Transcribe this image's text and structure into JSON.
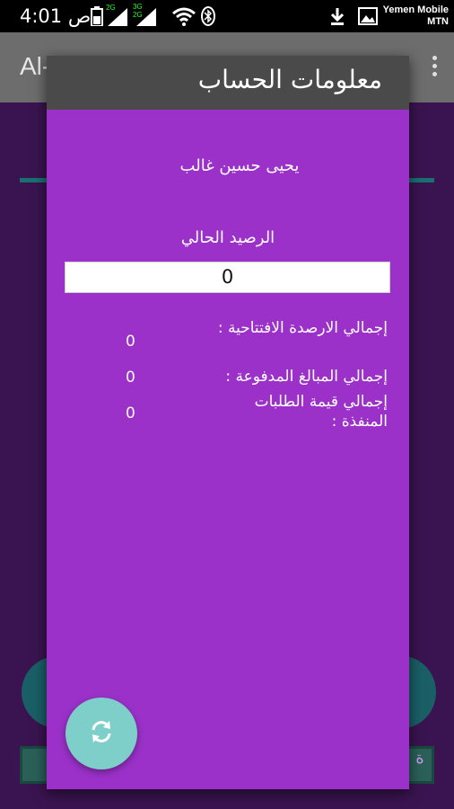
{
  "status_bar": {
    "time": "4:01 ص",
    "carrier_line1": "Yemen Mobile",
    "carrier_line2": "MTN",
    "net_label_1": "2G",
    "net_label_2a": "3G",
    "net_label_2b": "2G"
  },
  "background_app": {
    "title": "Al-",
    "bottom_right_char": "ة"
  },
  "dialog": {
    "title": "معلومات الحساب",
    "owner_name": "يحيى حسين غالب",
    "balance_label": "الرصيد الحالي",
    "balance_value": "0",
    "rows": [
      {
        "label": "إجمالي الارصدة الافتتاحية :",
        "value": "0"
      },
      {
        "label": "إجمالي المبالغ المدفوعة :",
        "value": "0"
      },
      {
        "label": "إجمالي قيمة الطلبات المنفذة :",
        "value": "0"
      }
    ]
  },
  "icons": {
    "refresh": "refresh-icon",
    "download": "download-icon",
    "image": "image-icon",
    "wifi": "wifi-icon",
    "bluetooth": "bluetooth-icon",
    "battery": "battery-icon",
    "signal": "signal-icon"
  },
  "colors": {
    "dialog_bg": "#9b31c9",
    "dialog_header": "#4a4a4a",
    "fab": "#7ecec9",
    "background": "#3a1450"
  }
}
